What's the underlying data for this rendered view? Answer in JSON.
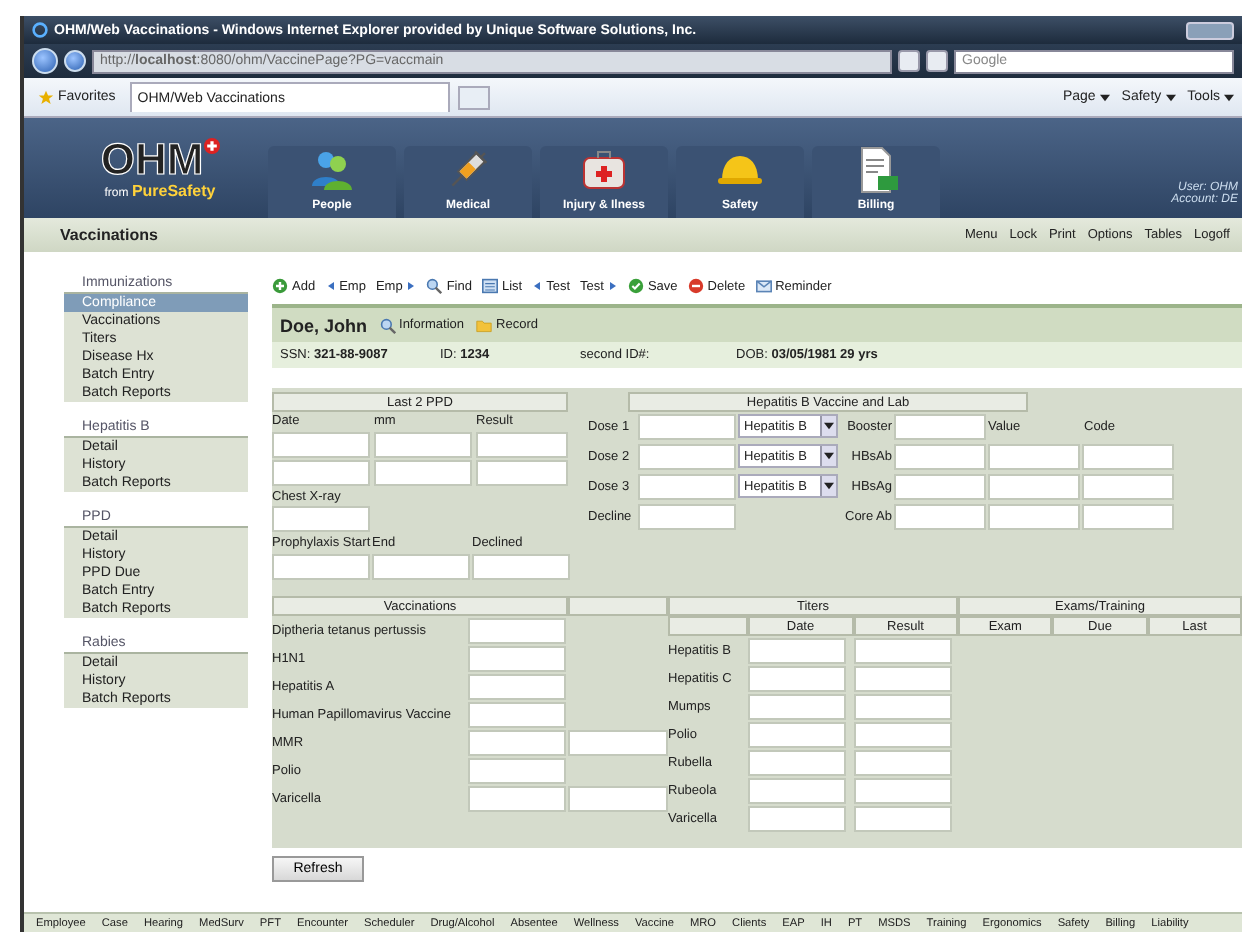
{
  "browser": {
    "title": "OHM/Web Vaccinations - Windows Internet Explorer provided by Unique Software Solutions, Inc.",
    "url": "http://**localhost**:8080/ohm/VaccinePage?PG=vaccmain",
    "search_placeholder": "Google",
    "favorites": "Favorites",
    "tab": "OHM/Web Vaccinations",
    "commands": [
      "Page",
      "Safety",
      "Tools"
    ]
  },
  "app": {
    "logo": "OHM",
    "logo_from": "from",
    "logo_brand": "PureSafety",
    "modules": [
      {
        "label": "People",
        "kind": "people",
        "selected": false
      },
      {
        "label": "Medical",
        "kind": "syringe",
        "selected": false
      },
      {
        "label": "Injury & Ilness",
        "kind": "firstaid",
        "selected": false
      },
      {
        "label": "Safety",
        "kind": "hardhat",
        "selected": false
      },
      {
        "label": "Billing",
        "kind": "document",
        "selected": false
      }
    ],
    "user": "User: OHM",
    "account": "Account: DE"
  },
  "page": {
    "title": "Vaccinations",
    "links": [
      "Menu",
      "Lock",
      "Print",
      "Options",
      "Tables",
      "Logoff"
    ]
  },
  "sidebar": [
    {
      "heading": "Immunizations",
      "items": [
        {
          "label": "Compliance",
          "selected": true
        },
        {
          "label": "Vaccinations",
          "selected": false
        },
        {
          "label": "Titers",
          "selected": false
        },
        {
          "label": "Disease Hx",
          "selected": false
        },
        {
          "label": "Batch Entry",
          "selected": false
        },
        {
          "label": "Batch Reports",
          "selected": false
        }
      ]
    },
    {
      "heading": "Hepatitis B",
      "items": [
        {
          "label": "Detail",
          "selected": false
        },
        {
          "label": "History",
          "selected": false
        },
        {
          "label": "Batch Reports",
          "selected": false
        }
      ]
    },
    {
      "heading": "PPD",
      "items": [
        {
          "label": "Detail",
          "selected": false
        },
        {
          "label": "History",
          "selected": false
        },
        {
          "label": "PPD Due",
          "selected": false
        },
        {
          "label": "Batch Entry",
          "selected": false
        },
        {
          "label": "Batch Reports",
          "selected": false
        }
      ]
    },
    {
      "heading": "Rabies",
      "items": [
        {
          "label": "Detail",
          "selected": false
        },
        {
          "label": "History",
          "selected": false
        },
        {
          "label": "Batch Reports",
          "selected": false
        }
      ]
    }
  ],
  "toolbar": [
    {
      "label": "Add",
      "kind": "add"
    },
    {
      "label": "Emp",
      "kind": "prev"
    },
    {
      "label": "Emp",
      "kind": "next"
    },
    {
      "label": "Find",
      "kind": "find"
    },
    {
      "label": "List",
      "kind": "list"
    },
    {
      "label": "Test",
      "kind": "prev"
    },
    {
      "label": "Test",
      "kind": "next"
    },
    {
      "label": "Save",
      "kind": "save"
    },
    {
      "label": "Delete",
      "kind": "delete"
    },
    {
      "label": "Reminder",
      "kind": "mail"
    }
  ],
  "patient": {
    "name": "Doe, John",
    "links": [
      {
        "label": "Information",
        "kind": "find"
      },
      {
        "label": "Record",
        "kind": "folder"
      }
    ],
    "fields": [
      {
        "label": "SSN:",
        "value": "321-88-9087"
      },
      {
        "label": "ID:",
        "value": "1234"
      },
      {
        "label": "second ID#:"
      },
      {
        "label": "DOB:",
        "value": "03/05/1981 29 yrs"
      }
    ]
  },
  "ppd": {
    "title": "Last 2 PPD",
    "columns": [
      "Date",
      "mm",
      "Result"
    ],
    "chest_xray": "Chest X-ray",
    "prophylaxis": [
      "Prophylaxis Start",
      "End",
      "Declined"
    ]
  },
  "hepatitis_b": {
    "title": "Hepatitis B Vaccine and Lab",
    "doses": [
      {
        "label": "Dose 1",
        "vaccine": "Hepatitis B"
      },
      {
        "label": "Dose 2",
        "vaccine": "Hepatitis B"
      },
      {
        "label": "Dose 3",
        "vaccine": "Hepatitis B"
      }
    ],
    "decline": "Decline",
    "lab_columns": [
      "Value",
      "Code"
    ],
    "labs": [
      {
        "label": "Booster",
        "kind": "single"
      },
      {
        "label": "HBsAb",
        "kind": "triple"
      },
      {
        "label": "HBsAg",
        "kind": "triple"
      },
      {
        "label": "Core Ab",
        "kind": "triple"
      }
    ]
  },
  "vaccinations": {
    "title": "Vaccinations",
    "items": [
      {
        "label": "Diptheria tetanus pertussis",
        "kind": "single"
      },
      {
        "label": "H1N1",
        "kind": "single"
      },
      {
        "label": "Hepatitis A",
        "kind": "single"
      },
      {
        "label": "Human Papillomavirus Vaccine",
        "kind": "single"
      },
      {
        "label": "MMR",
        "kind": "double"
      },
      {
        "label": "Polio",
        "kind": "single"
      },
      {
        "label": "Varicella",
        "kind": "double"
      }
    ]
  },
  "titers": {
    "title": "Titers",
    "columns": [
      "Date",
      "Result"
    ],
    "items": [
      "Hepatitis B",
      "Hepatitis C",
      "Mumps",
      "Polio",
      "Rubella",
      "Rubeola",
      "Varicella"
    ]
  },
  "exams": {
    "title": "Exams/Training",
    "columns": [
      "Exam",
      "Due",
      "Last"
    ]
  },
  "refresh": "Refresh",
  "bottom_nav": [
    "Employee",
    "Case",
    "Hearing",
    "MedSurv",
    "PFT",
    "Encounter",
    "Scheduler",
    "Drug/Alcohol",
    "Absentee",
    "Wellness",
    "Vaccine",
    "MRO",
    "Clients",
    "EAP",
    "IH",
    "PT",
    "MSDS",
    "Training",
    "Ergonomics",
    "Safety",
    "Billing",
    "Liability"
  ]
}
